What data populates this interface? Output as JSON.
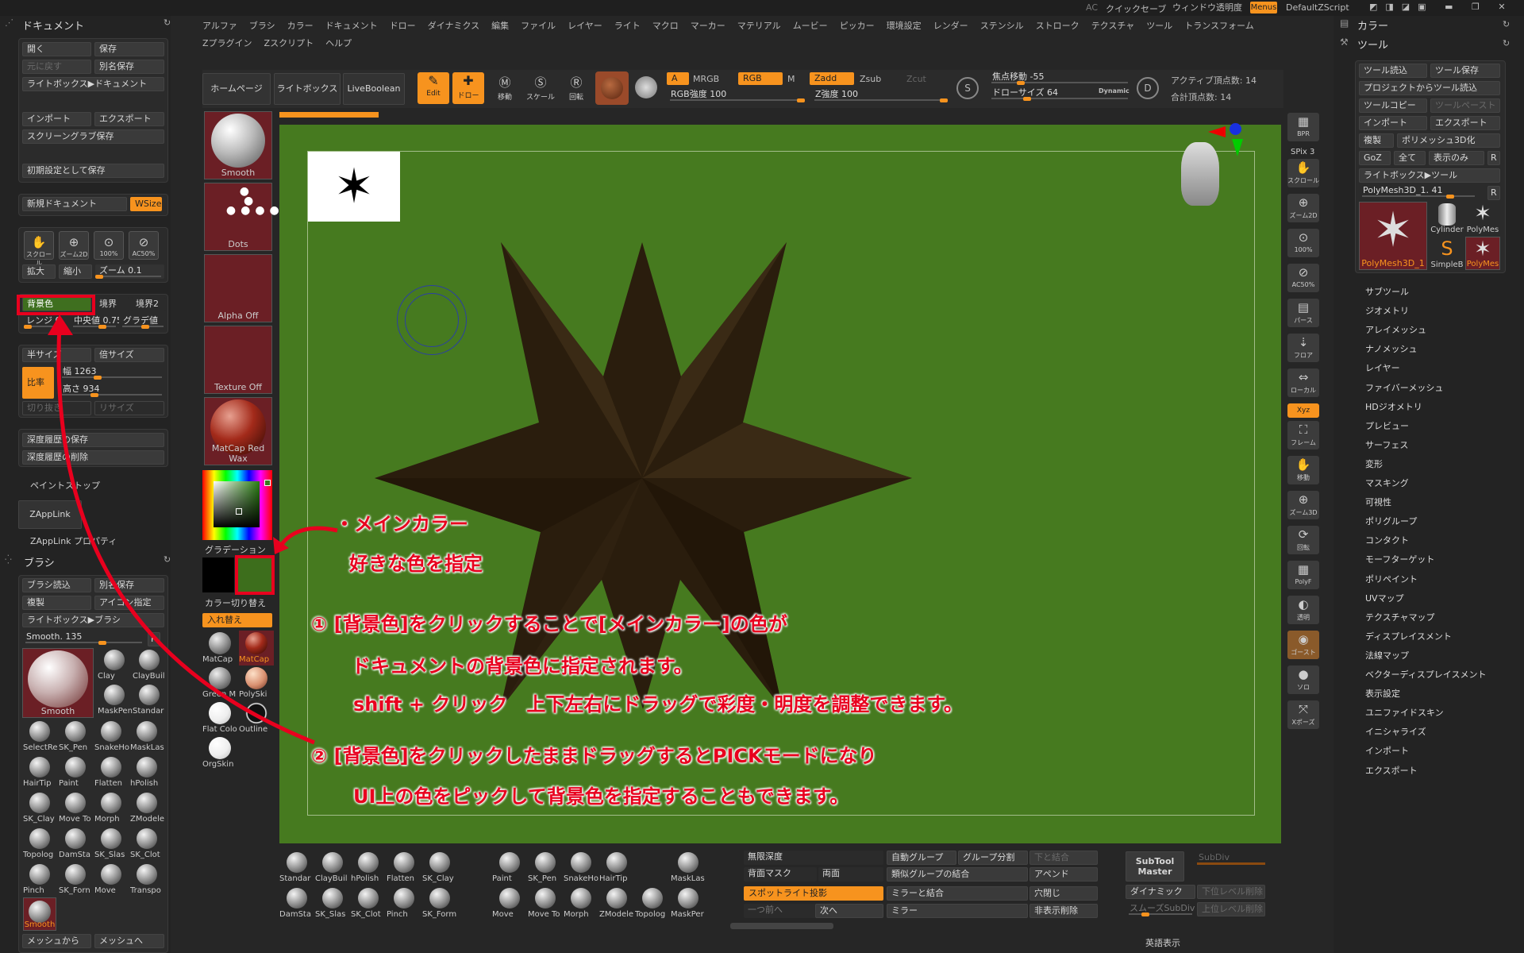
{
  "topbar": {
    "ac": "AC",
    "quicksave": "クイックセーブ",
    "transparency": "ウィンドウ透明度",
    "menus": "Menus",
    "script": "DefaultZScript"
  },
  "main_menu_row1": [
    "アルファ",
    "ブラシ",
    "カラー",
    "ドキュメント",
    "ドロー",
    "ダイナミクス",
    "編集",
    "ファイル",
    "レイヤー",
    "ライト",
    "マクロ",
    "マーカー",
    "マテリアル",
    "ムービー",
    "ピッカー",
    "環境設定",
    "レンダー",
    "ステンシル",
    "ストローク",
    "テクスチャ",
    "ツール",
    "トランスフォーム"
  ],
  "main_menu_row2": [
    "Zプラグイン",
    "Zスクリプト",
    "ヘルプ"
  ],
  "toolbar": {
    "home": "ホームページ",
    "lightbox": "ライトボックス",
    "liveboolean": "LiveBoolean",
    "edit": "Edit",
    "draw": "ドロー",
    "move": "移動",
    "scale": "スケール",
    "rotate": "回転",
    "a": "A",
    "mrgb": "MRGB",
    "rgb": "RGB",
    "m": "M",
    "rgb_intensity": "RGB強度 100",
    "zadd": "Zadd",
    "zsub": "Zsub",
    "zcut": "Zcut",
    "z_intensity": "Z強度 100",
    "focal": "焦点移動 -55",
    "drawsize": "ドローサイズ 64",
    "dynamic": "Dynamic",
    "active_points": "アクティブ頂点数: 14",
    "total_points": "合計頂点数: 14"
  },
  "document_panel": {
    "title": "ドキュメント",
    "open": "開く",
    "save": "保存",
    "revert": "元に戻す",
    "save_as": "別名保存",
    "lightbox_doc": "ライトボックス▶ドキュメント",
    "import": "インポート",
    "export": "エクスポート",
    "screengrab": "スクリーングラブ保存",
    "save_default": "初期設定として保存",
    "new_doc": "新規ドキュメント",
    "wsize": "WSize",
    "scroll": "スクロール",
    "zoom2d": "ズーム2D",
    "p100": "100%",
    "aac50": "AC50%",
    "expand": "拡大",
    "shrink": "縮小",
    "zoom": "ズーム 0.1",
    "back": "背景色",
    "border": "境界",
    "border2": "境界2",
    "range": "レンジ 0",
    "center": "中央値 0.75",
    "gradient": "グラデ値",
    "half": "半サイズ",
    "double": "倍サイズ",
    "ratio": "比率",
    "width": "幅 1263",
    "height": "高さ 934",
    "crop": "切り抜き",
    "resize": "リサイズ",
    "depth_save": "深度履歴の保存",
    "depth_del": "深度履歴の削除",
    "paintstop": "ペイントストップ",
    "zapplink": "ZAppLink",
    "zapplink_prop": "ZAppLink プロパティ"
  },
  "brush_panel": {
    "title": "ブラシ",
    "load": "ブラシ読込",
    "save_as": "別名保存",
    "clone": "複製",
    "icon": "アイコン指定",
    "lightbox": "ライトボックス▶ブラシ",
    "smooth": "Smooth. 135",
    "r": "R",
    "big": "Smooth",
    "grid": [
      "Clay",
      "ClayBuil",
      "MaskPen",
      "Standar",
      "SelectRe",
      "SK_Pen",
      "SnakeHo",
      "MaskLas",
      "HairTip",
      "Paint",
      "Flatten",
      "hPolish",
      "SK_Clay",
      "Move To",
      "Morph",
      "ZModele",
      "Topolog",
      "DamSta",
      "SK_Slas",
      "SK_Clot",
      "Pinch",
      "SK_Forn",
      "Move",
      "Transpo"
    ],
    "bottom": "Smooth",
    "from_mesh": "メッシュから",
    "to_mesh": "メッシュへ"
  },
  "shelf": {
    "smooth": "Smooth",
    "dots": "Dots",
    "alpha": "Alpha Off",
    "texture": "Texture Off",
    "matcap": "MatCap Red Wax",
    "gradation": "グラデーション",
    "switch": "カラー切り替え",
    "swap": "入れ替え",
    "mat": [
      "MatCap",
      "MatCap",
      "Green M",
      "PolySki",
      "Flat Colo",
      "Outline",
      "OrgSkin"
    ]
  },
  "colors": {
    "canvas_bg": "#467a1f",
    "main_color": "#3d6e1c",
    "accent": "#f7931e",
    "star": "#2a1d0d"
  },
  "right_panel": {
    "color": "カラー",
    "tool": "ツール",
    "load": "ツール読込",
    "save": "ツール保存",
    "proj_load": "プロジェクトからツール読込",
    "copy": "ツールコピー",
    "paste": "ツールペースト",
    "import": "インポート",
    "export": "エクスポート",
    "clone": "複製",
    "polymesh": "ポリメッシュ3D化",
    "goz": "GoZ",
    "all": "全て",
    "visible": "表示のみ",
    "r": "R",
    "lightbox": "ライトボックス▶ツール",
    "current": "PolyMesh3D_1. 41",
    "thumbs": [
      "PolyMesh3D_1",
      "Cylinder",
      "PolyMes",
      "SimpleB",
      "PolyMes"
    ],
    "list": [
      "サブツール",
      "ジオメトリ",
      "アレイメッシュ",
      "ナノメッシュ",
      "レイヤー",
      "ファイバーメッシュ",
      "HDジオメトリ",
      "プレビュー",
      "サーフェス",
      "変形",
      "マスキング",
      "可視性",
      "ポリグループ",
      "コンタクト",
      "モーフターゲット",
      "ポリペイント",
      "UVマップ",
      "テクスチャマップ",
      "ディスプレイスメント",
      "法線マップ",
      "ベクターディスプレイスメント",
      "表示設定",
      "ユニファイドスキン",
      "イニシャライズ",
      "インポート",
      "エクスポート"
    ]
  },
  "right_tools": [
    "BPR",
    "SPix 3",
    "スクロール",
    "ズーム2D",
    "100%",
    "AC50%",
    "パース",
    "フロア",
    "ローカル",
    "Xyz",
    "フレーム",
    "移動",
    "ズーム3D",
    "回転",
    "PolyF",
    "透明",
    "ゴースト",
    "ソロ",
    "Xポーズ"
  ],
  "bottom": {
    "brushes": [
      "Standar",
      "ClayBuil",
      "hPolish",
      "Flatten",
      "SK_Clay",
      "Paint",
      "SK_Pen",
      "SnakeHo",
      "HairTip",
      "MaskLas",
      "DamSta",
      "SK_Slas",
      "SK_Clot",
      "Pinch",
      "SK_Form",
      "Move",
      "Move To",
      "Morph",
      "ZModele",
      "Topolog",
      "MaskPer"
    ],
    "infinite_depth": "無限深度",
    "back_mask": "背面マスク",
    "both": "両面",
    "spotlight": "スポットライト投影",
    "prev": "一つ前へ",
    "next": "次へ",
    "auto_group": "自動グループ",
    "group_split": "グループ分割",
    "merge_down": "下と結合",
    "similar": "類似グループの結合",
    "append": "アペンド",
    "mirror_merge": "ミラーと結合",
    "close_holes": "穴閉じ",
    "mirror": "ミラー",
    "del_hidden": "非表示削除",
    "subtool_master": "SubTool Master",
    "subdiv": "SubDiv",
    "dynamic": "ダイナミック",
    "del_lower": "下位レベル削除",
    "smooth_subdiv": "スムーズSubDiv",
    "del_higher": "上位レベル削除",
    "english": "英語表示"
  },
  "annotations": {
    "main_color_title": "・メインカラー",
    "main_color_desc": "好きな色を指定",
    "step1_line1": "① [背景色]をクリックすることで[メインカラー]の色が",
    "step1_line2": "ドキュメントの背景色に指定されます。",
    "step1_line3": "shift + クリック　上下左右にドラッグで彩度・明度を調整できます。",
    "step2_line1": "② [背景色]をクリックしたままドラッグするとPICKモードになり",
    "step2_line2": "UI上の色をピックして背景色を指定することもできます。"
  }
}
